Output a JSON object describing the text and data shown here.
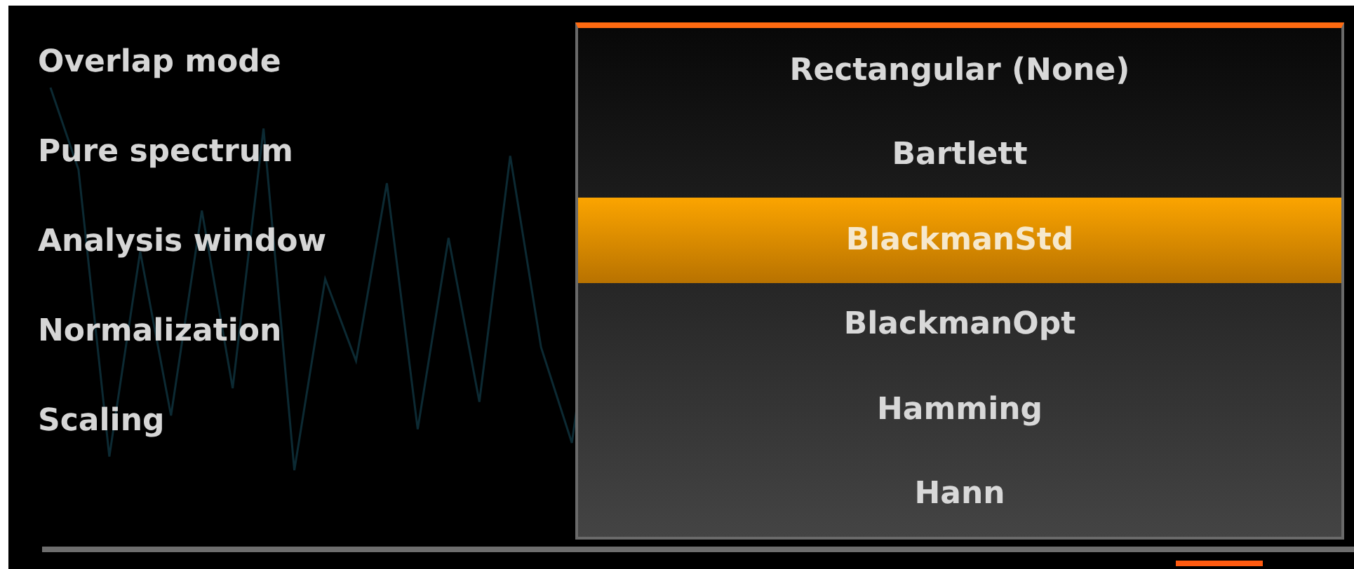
{
  "settings": [
    {
      "label": "Overlap mode"
    },
    {
      "label": "Pure spectrum"
    },
    {
      "label": "Analysis window"
    },
    {
      "label": "Normalization"
    },
    {
      "label": "Scaling"
    }
  ],
  "dropdown": {
    "options": [
      {
        "label": "Rectangular (None)",
        "selected": false
      },
      {
        "label": "Bartlett",
        "selected": false
      },
      {
        "label": "BlackmanStd",
        "selected": true
      },
      {
        "label": "BlackmanOpt",
        "selected": false
      },
      {
        "label": "Hamming",
        "selected": false
      },
      {
        "label": "Hann",
        "selected": false
      }
    ]
  }
}
